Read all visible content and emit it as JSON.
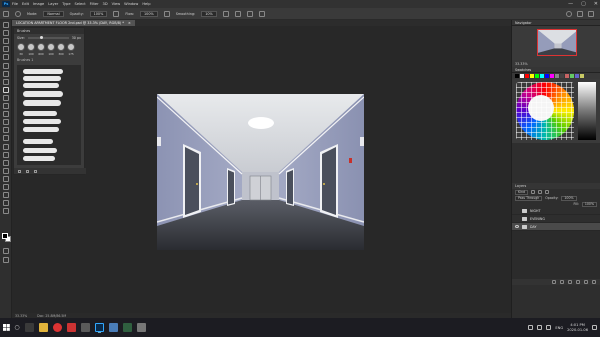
{
  "app": {
    "logo": "Ps",
    "menu": [
      "File",
      "Edit",
      "Image",
      "Layer",
      "Type",
      "Select",
      "Filter",
      "3D",
      "View",
      "Window",
      "Help"
    ],
    "window_controls": [
      "—",
      "▢",
      "✕"
    ]
  },
  "options_bar": {
    "mode_label": "Mode:",
    "mode_value": "Normal",
    "opacity_label": "Opacity:",
    "opacity_value": "100%",
    "flow_label": "Flow:",
    "flow_value": "100%",
    "smoothing_label": "Smoothing:",
    "smoothing_value": "10%"
  },
  "document": {
    "tab_title": "LOCATION APARTMENT FLOOR 2nd.psd @ 33.3% (DAY, RGB/8) *",
    "close_glyph": "×",
    "status_zoom": "33.33%",
    "status_size": "Doc: 25.8M/86.5M"
  },
  "brushes_panel": {
    "title": "Brushes",
    "size_label": "Size:",
    "size_value": "30 px",
    "preset_sizes": [
      "30",
      "100",
      "600",
      "100",
      "300",
      "175"
    ],
    "folder_label": "Brushes 1"
  },
  "navigator": {
    "title": "Navigator",
    "zoom": "33.33%"
  },
  "swatches": {
    "title": "Swatches",
    "colors": [
      "#000000",
      "#ffffff",
      "#ff0000",
      "#ffff00",
      "#00ff00",
      "#00ffff",
      "#0000ff",
      "#ff00ff",
      "#888888",
      "#444444",
      "#c86464",
      "#64c864",
      "#6464c8",
      "#c8c864"
    ]
  },
  "layers": {
    "title": "Layers",
    "kind_label": "Kind",
    "blend_mode": "Pass Through",
    "opacity_label": "Opacity:",
    "opacity_value": "100%",
    "fill_label": "Fill:",
    "fill_value": "100%",
    "items": [
      {
        "name": "NIGHT",
        "visible": false,
        "selected": false
      },
      {
        "name": "EVENING",
        "visible": false,
        "selected": false
      },
      {
        "name": "DAY",
        "visible": true,
        "selected": true
      }
    ]
  },
  "taskbar": {
    "time": "4:01 PM",
    "date": "2020-01-06",
    "lang": "ENG"
  }
}
